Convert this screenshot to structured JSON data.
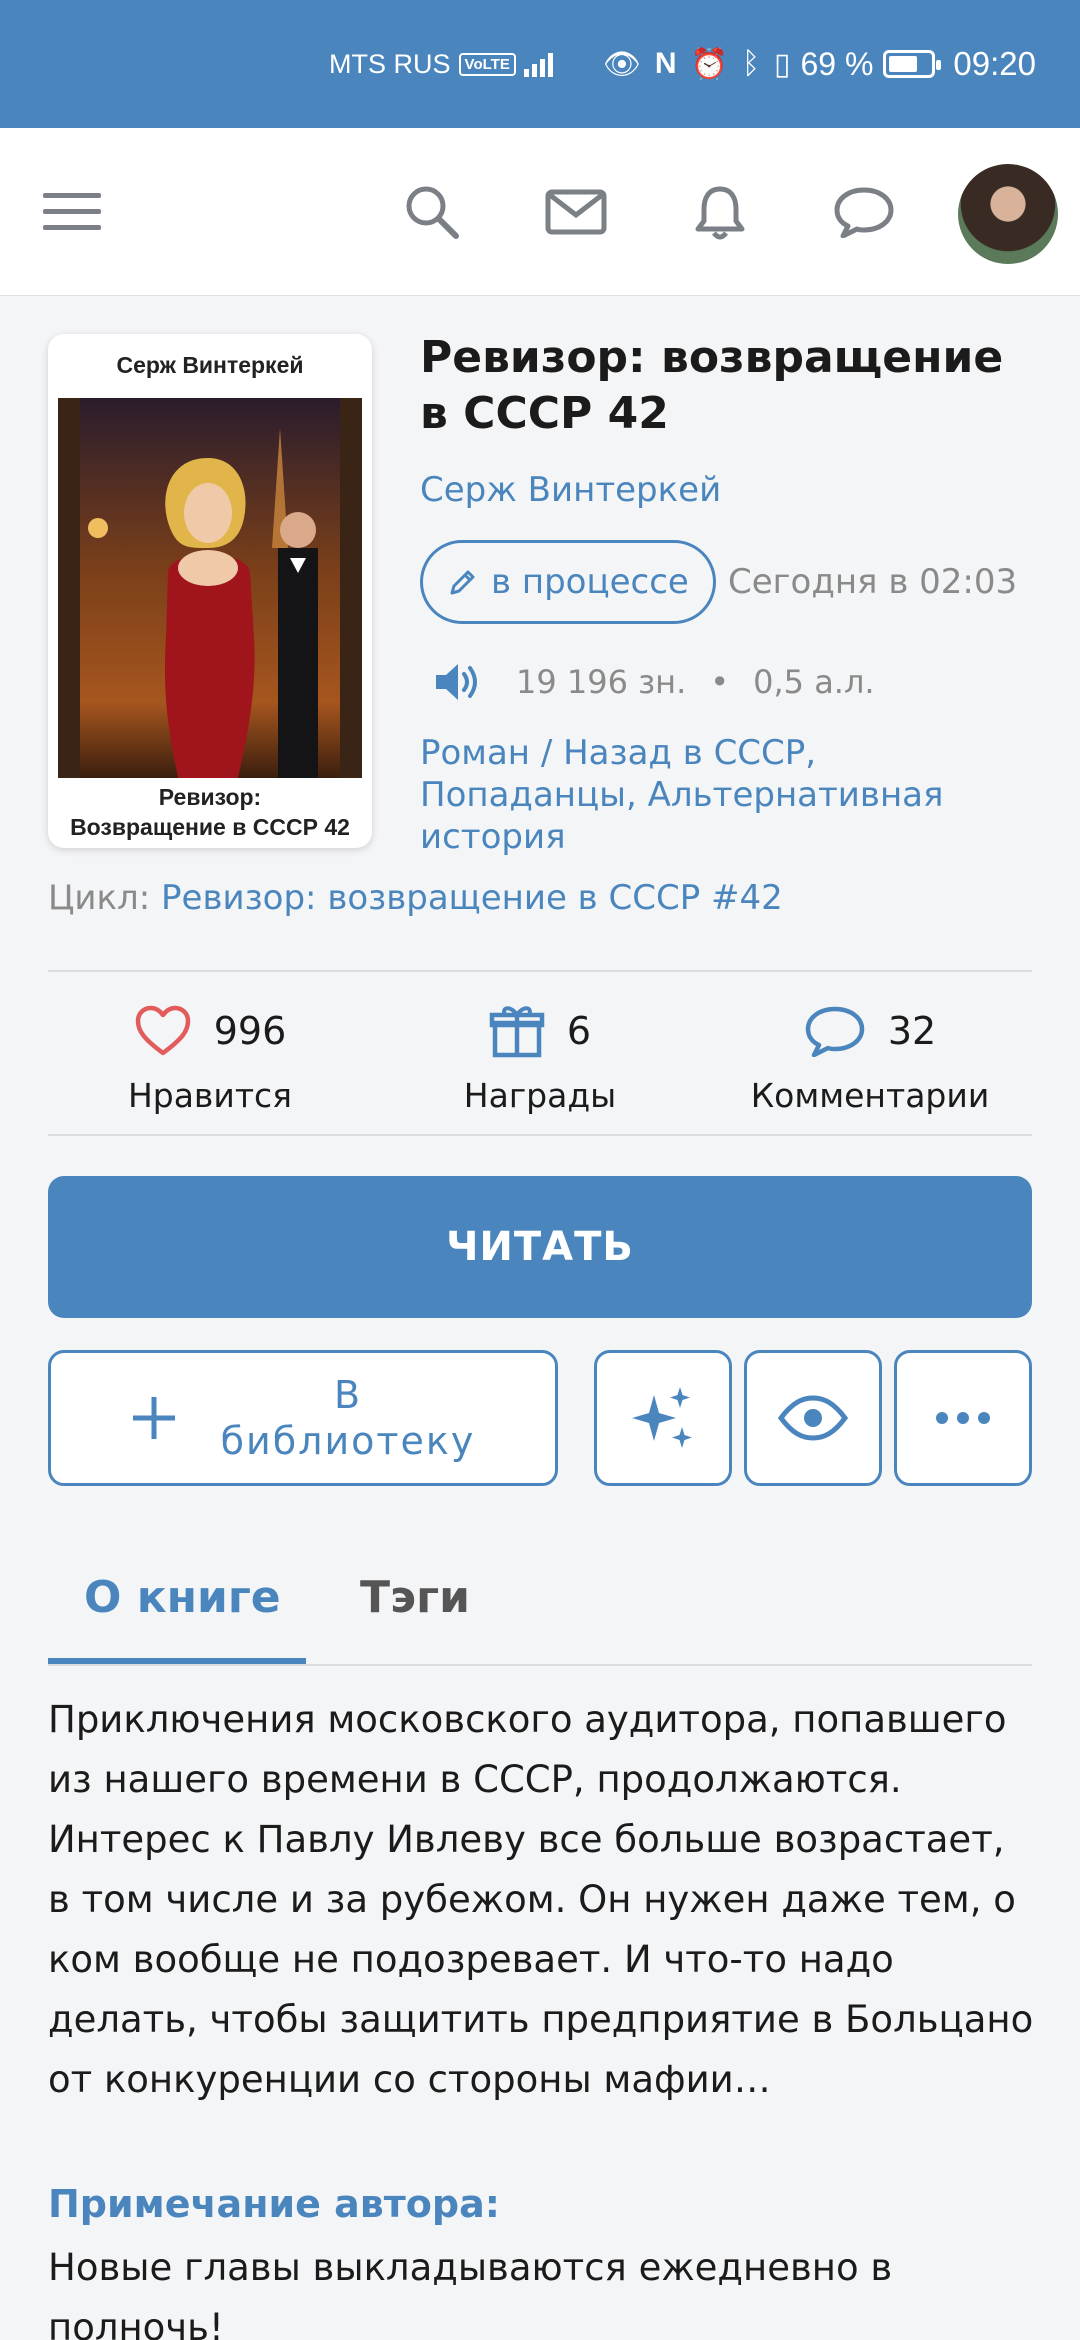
{
  "status_bar": {
    "carrier": "MTS RUS",
    "volte": "VoLTE",
    "network": "4G",
    "battery_percent": "69 %",
    "battery_level": 0.69,
    "time": "09:20"
  },
  "nav": {
    "icons": [
      "menu-icon",
      "search-icon",
      "mail-icon",
      "bell-icon",
      "chat-icon"
    ]
  },
  "book": {
    "cover_author": "Серж Винтеркей",
    "cover_title_line1": "Ревизор:",
    "cover_title_line2": "Возвращение в СССР 42",
    "title": "Ревизор: возвращение в СССР 42",
    "author": "Серж Винтеркей",
    "status": "в процессе",
    "updated": "Сегодня в 02:03",
    "chars": "19 196 зн.",
    "separator": "•",
    "sheets": "0,5 а.л.",
    "genres": "Роман / Назад в СССР, Попаданцы, Альтернативная история",
    "cycle_label": "Цикл:",
    "cycle_name": "Ревизор: возвращение в СССР #42"
  },
  "stats": {
    "likes": {
      "value": "996",
      "label": "Нравится"
    },
    "awards": {
      "value": "6",
      "label": "Награды"
    },
    "comments": {
      "value": "32",
      "label": "Комментарии"
    }
  },
  "actions": {
    "read": "ЧИТАТЬ",
    "library_line1": "В",
    "library_line2": "библиотеку"
  },
  "tabs": {
    "about": "О книге",
    "tags": "Тэги"
  },
  "description": "Приключения московского аудитора, попавшего из нашего времени в СССР, продолжаются. Интерес к Павлу Ивлеву все больше возрастает, в том числе и за рубежом. Он нужен даже тем, о ком вообще не подозревает. И что-то надо делать, чтобы защитить предприятие в Больцано от конкуренции со стороны мафии…",
  "note": {
    "heading": "Примечание автора:",
    "text": "Новые главы выкладываются ежедневно в полночь!"
  },
  "colors": {
    "accent": "#4a86bd",
    "like": "#e25c5c",
    "muted": "#8a8a8a"
  }
}
